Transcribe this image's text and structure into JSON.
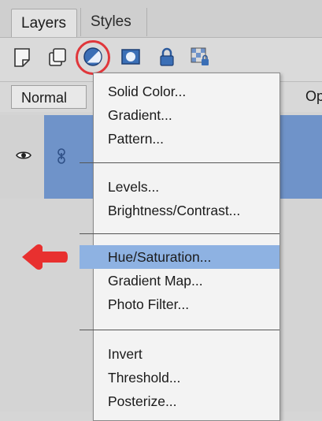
{
  "tabs": [
    {
      "label": "Layers",
      "active": true
    },
    {
      "label": "Styles",
      "active": false
    }
  ],
  "toolbar": {
    "icons": [
      "new-layer-icon",
      "new-group-icon",
      "adjustment-layer-icon",
      "layer-mask-icon",
      "lock-all-icon",
      "lock-transparency-icon"
    ],
    "highlight_color": "#e0373b"
  },
  "blend_mode": {
    "value": "Normal"
  },
  "opacity": {
    "label": "Op"
  },
  "layer": {
    "selected_color": "#6f93c9"
  },
  "menu": {
    "groups": [
      [
        "Solid Color...",
        "Gradient...",
        "Pattern..."
      ],
      [
        "Levels...",
        "Brightness/Contrast..."
      ],
      [
        "Hue/Saturation...",
        "Gradient Map...",
        "Photo Filter..."
      ],
      [
        "Invert",
        "Threshold...",
        "Posterize..."
      ]
    ],
    "highlighted_item": "Hue/Saturation...",
    "highlight_color": "#8eb2e2"
  },
  "annotation": {
    "arrow_color": "#e8302f"
  }
}
